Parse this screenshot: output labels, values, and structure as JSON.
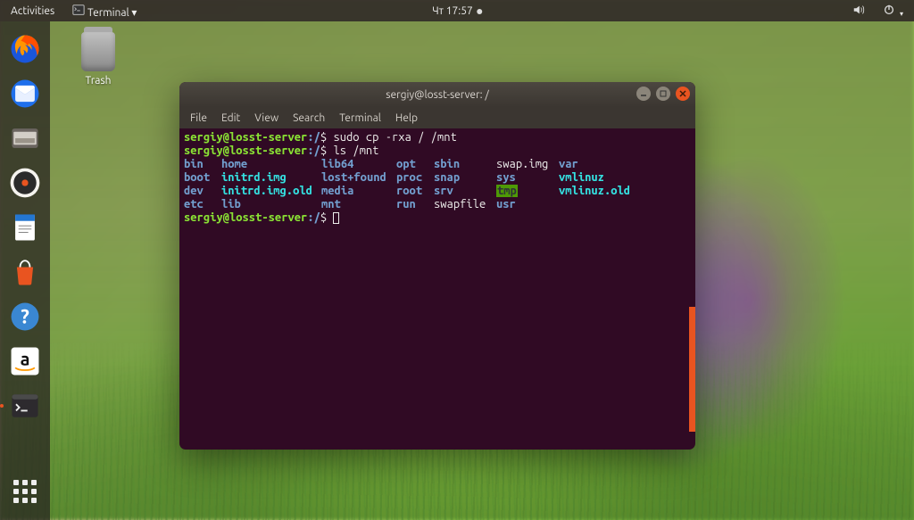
{
  "topbar": {
    "activities": "Activities",
    "app_indicator": "Terminal ▾",
    "clock": "Чт 17:57"
  },
  "desktop": {
    "trash_label": "Trash"
  },
  "launcher": {
    "apps": [
      {
        "name": "firefox"
      },
      {
        "name": "thunderbird"
      },
      {
        "name": "files"
      },
      {
        "name": "rhythmbox"
      },
      {
        "name": "libreoffice-writer"
      },
      {
        "name": "software-center"
      },
      {
        "name": "help"
      },
      {
        "name": "amazon"
      },
      {
        "name": "terminal",
        "active": true
      }
    ]
  },
  "window": {
    "title": "sergiy@losst-server: /",
    "menu": [
      "File",
      "Edit",
      "View",
      "Search",
      "Terminal",
      "Help"
    ]
  },
  "terminal": {
    "prompt_user": "sergiy@losst-server",
    "prompt_path": "/",
    "prompt_sep": ":",
    "prompt_dollar": "$",
    "cmd1": "sudo cp -rxa / /mnt",
    "cmd2": "ls /mnt",
    "rows": [
      [
        "bin",
        "home",
        "lib64",
        "opt",
        "sbin",
        "swap.img",
        "var"
      ],
      [
        "boot",
        "initrd.img",
        "lost+found",
        "proc",
        "snap",
        "sys",
        "vmlinuz"
      ],
      [
        "dev",
        "initrd.img.old",
        "media",
        "root",
        "srv",
        "tmp",
        "vmlinuz.old"
      ],
      [
        "etc",
        "lib",
        "mnt",
        "run",
        "swapfile",
        "usr",
        ""
      ]
    ],
    "classes": [
      [
        "c-dir",
        "c-dir",
        "c-dir",
        "c-dir",
        "c-dir",
        "c-file",
        "c-dir"
      ],
      [
        "c-dir",
        "c-link",
        "c-dir",
        "c-dir",
        "c-dir",
        "c-dir",
        "c-link"
      ],
      [
        "c-dir",
        "c-link",
        "c-dir",
        "c-dir",
        "c-dir",
        "c-tmp",
        "c-link"
      ],
      [
        "c-dir",
        "c-dir",
        "c-dir",
        "c-dir",
        "c-file",
        "c-dir",
        ""
      ]
    ]
  }
}
